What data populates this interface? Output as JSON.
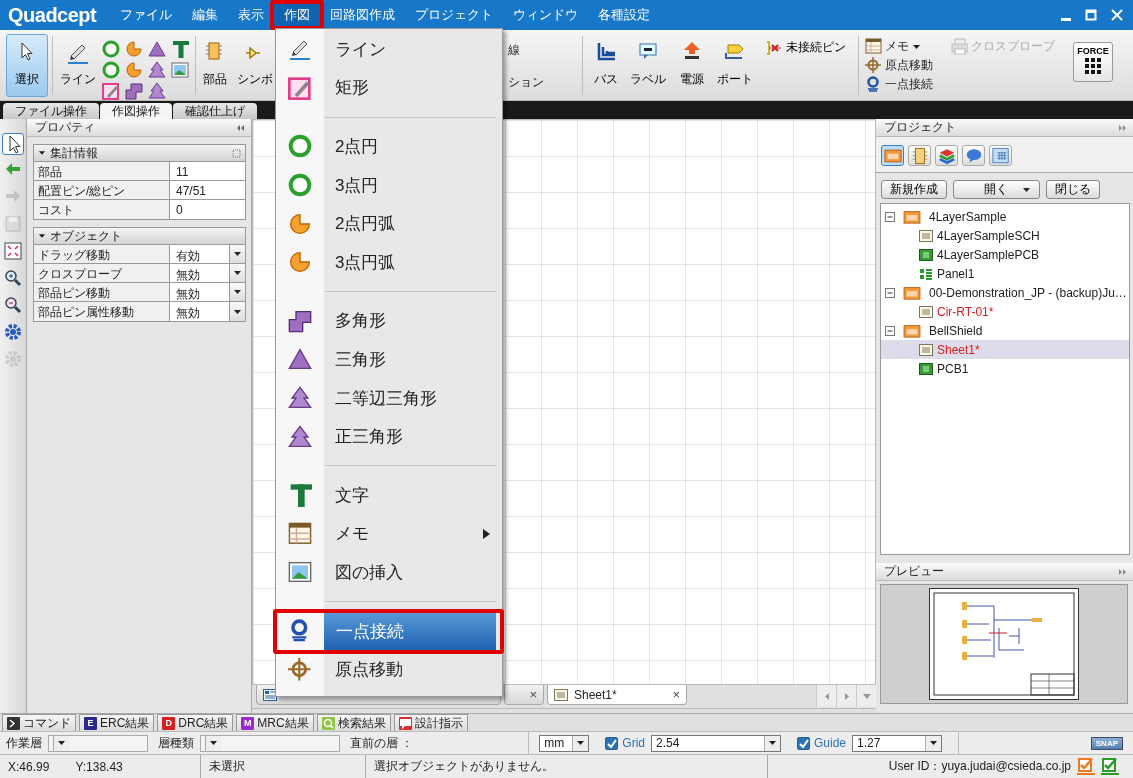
{
  "app": {
    "logo": "Quadcept"
  },
  "menu_bar": [
    {
      "label": "ファイル",
      "selected": false
    },
    {
      "label": "編集",
      "selected": false
    },
    {
      "label": "表示",
      "selected": false
    },
    {
      "label": "作図",
      "selected": true
    },
    {
      "label": "回路図作成",
      "selected": false
    },
    {
      "label": "プロジェクト",
      "selected": false
    },
    {
      "label": "ウィンドウ",
      "selected": false
    },
    {
      "label": "各種設定",
      "selected": false
    }
  ],
  "ribbon": {
    "select": {
      "label": "選択",
      "selected": true
    },
    "line": "ライン",
    "parts": "部品",
    "symbol": "シンボ",
    "hidden_top": "線",
    "hidden_bottom": "ション",
    "bus": "バス",
    "label": "ラベル",
    "power": "電源",
    "port": "ポート",
    "unconnected_pin": "未接続ピン",
    "memo": "メモ",
    "origin_move": "原点移動",
    "single_point": "一点接続",
    "cross_probe": {
      "label": "クロスプローブ",
      "disabled": true
    },
    "force": "FORCE"
  },
  "ribbon_tabs": [
    {
      "label": "ファイル操作",
      "selected": false
    },
    {
      "label": "作図操作",
      "selected": true
    },
    {
      "label": "確認仕上げ",
      "selected": false
    }
  ],
  "tool_strip": [
    {
      "selected": true,
      "disabled": false
    },
    {
      "selected": false,
      "disabled": false
    },
    {
      "selected": false,
      "disabled": true
    },
    {
      "selected": false,
      "disabled": true
    },
    {
      "selected": false,
      "disabled": false
    },
    {
      "selected": false,
      "disabled": false
    },
    {
      "selected": false,
      "disabled": false
    },
    {
      "selected": false,
      "disabled": false
    },
    {
      "selected": false,
      "disabled": true
    }
  ],
  "properties": {
    "title": "プロパティ",
    "sections": [
      {
        "title": "集計情報",
        "expanded": true,
        "rows": [
          {
            "name": "部品",
            "value": "11",
            "kind": "text"
          },
          {
            "name": "配置ピン/総ピン",
            "value": "47/51",
            "kind": "text"
          },
          {
            "name": "コスト",
            "value": "0",
            "kind": "text"
          }
        ]
      },
      {
        "title": "オブジェクト",
        "expanded": true,
        "rows": [
          {
            "name": "ドラッグ移動",
            "value": "有効",
            "kind": "dropdown"
          },
          {
            "name": "クロスプローブ",
            "value": "無効",
            "kind": "dropdown"
          },
          {
            "name": "部品ピン移動",
            "value": "無効",
            "kind": "dropdown"
          },
          {
            "name": "部品ピン属性移動",
            "value": "無効",
            "kind": "dropdown"
          }
        ]
      }
    ]
  },
  "menu": [
    {
      "kind": "item",
      "label": "ライン",
      "selected": false,
      "submenu": false
    },
    {
      "kind": "item",
      "label": "矩形",
      "selected": false,
      "submenu": false
    },
    {
      "kind": "separator"
    },
    {
      "kind": "item",
      "label": "2点円",
      "selected": false,
      "submenu": false
    },
    {
      "kind": "item",
      "label": "3点円",
      "selected": false,
      "submenu": false
    },
    {
      "kind": "item",
      "label": "2点円弧",
      "selected": false,
      "submenu": false
    },
    {
      "kind": "item",
      "label": "3点円弧",
      "selected": false,
      "submenu": false
    },
    {
      "kind": "separator"
    },
    {
      "kind": "item",
      "label": "多角形",
      "selected": false,
      "submenu": false
    },
    {
      "kind": "item",
      "label": "三角形",
      "selected": false,
      "submenu": false
    },
    {
      "kind": "item",
      "label": "二等辺三角形",
      "selected": false,
      "submenu": false
    },
    {
      "kind": "item",
      "label": "正三角形",
      "selected": false,
      "submenu": false
    },
    {
      "kind": "separator"
    },
    {
      "kind": "item",
      "label": "文字",
      "selected": false,
      "submenu": false
    },
    {
      "kind": "item",
      "label": "メモ",
      "selected": false,
      "submenu": true
    },
    {
      "kind": "item",
      "label": "図の挿入",
      "selected": false,
      "submenu": false
    },
    {
      "kind": "separator"
    },
    {
      "kind": "item",
      "label": "一点接続",
      "selected": true,
      "submenu": false
    },
    {
      "kind": "item",
      "label": "原点移動",
      "selected": false,
      "submenu": false
    }
  ],
  "doc_tabs": [
    {
      "selected": false
    },
    {
      "close": "×",
      "selected": false
    },
    {
      "label": "Sheet1*",
      "close": "×",
      "selected": true
    }
  ],
  "project": {
    "title": "プロジェクト",
    "view_buttons": [
      {
        "selected": true
      },
      {
        "selected": false
      },
      {
        "selected": false
      },
      {
        "selected": false
      },
      {
        "selected": false
      }
    ],
    "buttons": [
      {
        "label": "新規作成",
        "kind": "plain"
      },
      {
        "label": "開く",
        "kind": "dropdown"
      },
      {
        "label": "閉じる",
        "kind": "plain"
      }
    ],
    "tree": [
      {
        "kind": "project",
        "label": "4LayerSample",
        "expanded": true,
        "selected": false,
        "modified": false,
        "children": [
          {
            "kind": "sch",
            "label": "4LayerSampleSCH",
            "selected": false,
            "modified": false
          },
          {
            "kind": "pcb",
            "label": "4LayerSamplePCB",
            "selected": false,
            "modified": false
          },
          {
            "kind": "panel",
            "label": "Panel1",
            "selected": false,
            "modified": false
          }
        ]
      },
      {
        "kind": "project",
        "label": "00-Demonstration_JP - (backup)Ju…",
        "expanded": true,
        "selected": false,
        "modified": false,
        "children": [
          {
            "kind": "sch",
            "label": "Cir-RT-01*",
            "selected": false,
            "modified": true
          }
        ]
      },
      {
        "kind": "project",
        "label": "BellShield",
        "expanded": true,
        "selected": false,
        "modified": false,
        "children": [
          {
            "kind": "sch",
            "label": "Sheet1*",
            "selected": true,
            "modified": true
          },
          {
            "kind": "pcb",
            "label": "PCB1",
            "selected": false,
            "modified": false
          }
        ]
      }
    ]
  },
  "preview": {
    "title": "プレビュー"
  },
  "bottom_tabs": [
    {
      "label": "コマンド",
      "kind": "command",
      "color": "#333333"
    },
    {
      "label": "ERC結果",
      "kind": "letter",
      "badge": "E",
      "color": "#2a2a8c"
    },
    {
      "label": "DRC結果",
      "kind": "letter",
      "badge": "D",
      "color": "#d42020"
    },
    {
      "label": "MRC結果",
      "kind": "letter",
      "badge": "M",
      "color": "#9a2ad0"
    },
    {
      "label": "検索結果",
      "kind": "search",
      "color": "#8cc63f"
    },
    {
      "label": "設計指示",
      "kind": "note",
      "color": "#d83030"
    }
  ],
  "layer_bar": {
    "work_layer_label": "作業層",
    "layer_type_label": "層種類",
    "previous_layer_label": "直前の層 ：",
    "unit": "mm",
    "grid": {
      "label": "Grid",
      "checked": true,
      "value": "2.54"
    },
    "guide": {
      "label": "Guide",
      "checked": true,
      "value": "1.27"
    },
    "snap": "SNAP"
  },
  "status_bar": {
    "x": "X:46.99",
    "y": "Y:138.43",
    "selection": "未選択",
    "message": "選択オブジェクトがありません。",
    "user": "User ID：yuya.judai@csieda.co.jp"
  }
}
